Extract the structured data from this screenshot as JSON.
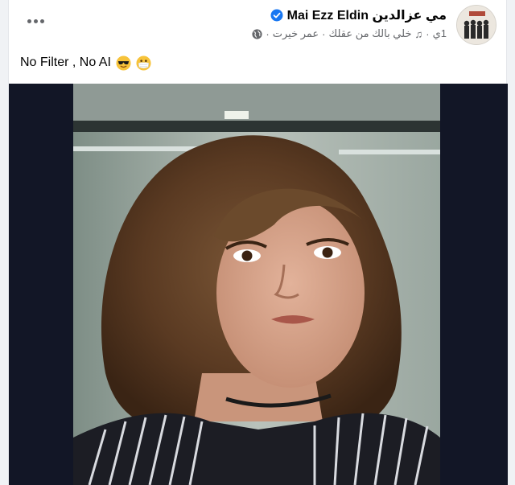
{
  "post": {
    "author_name": "Mai Ezz Eldin مي عزالدين",
    "meta": {
      "time": "1ي",
      "song": "خلي بالك من عقلك",
      "artist": "عمر خيرت",
      "separator": "·"
    },
    "caption": {
      "text": "No Filter , No AI",
      "emojis": [
        "smiling-face-with-sunglasses",
        "face-with-medical-mask"
      ]
    },
    "icons": {
      "verified": "verified-badge-icon",
      "music": "music-note-icon",
      "privacy": "globe-icon",
      "more": "more-options-icon"
    },
    "colors": {
      "verified": "#1877f2",
      "text_primary": "#050505",
      "text_secondary": "#65676b",
      "media_background": "#121626"
    }
  }
}
